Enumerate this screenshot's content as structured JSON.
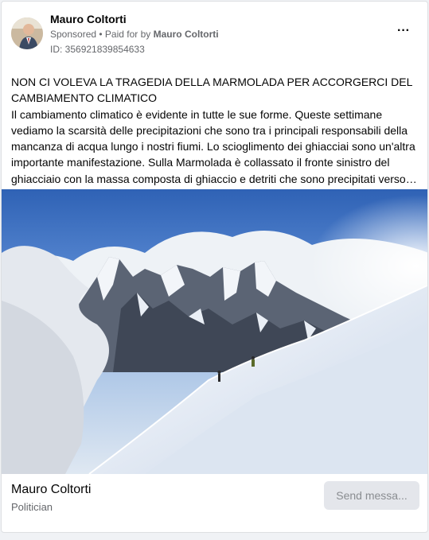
{
  "post": {
    "author": "Mauro Coltorti",
    "sponsored_label": "Sponsored",
    "paid_for_prefix": " • Paid for by ",
    "paid_for_name": "Mauro Coltorti",
    "ad_id": "ID: 356921839854633",
    "menu_icon": "more-horizontal-icon",
    "text_lines": [
      "NON CI VOLEVA LA TRAGEDIA DELLA MARMOLADA PER ACCORGERCI DEL CAMBIAMENTO CLIMATICO",
      "Il cambiamento climatico è evidente in tutte le sue forme. Queste settimane vediamo la scarsità delle precipitazioni che sono tra i principali responsabili della mancanza di acqua lungo i nostri fiumi. Lo scioglimento dei ghiacciai sono un'altra importante manifestazione. Sulla Marmolada è collassato il fronte sinistro del ghiacciaio con la massa composta di ghiaccio e detriti che sono precipitati verso…"
    ]
  },
  "footer": {
    "page_name": "Mauro Coltorti",
    "category": "Politician",
    "cta_label": "Send messa..."
  },
  "colors": {
    "primary_text": "#050505",
    "secondary_text": "#65676b",
    "button_bg": "#e4e6eb"
  }
}
